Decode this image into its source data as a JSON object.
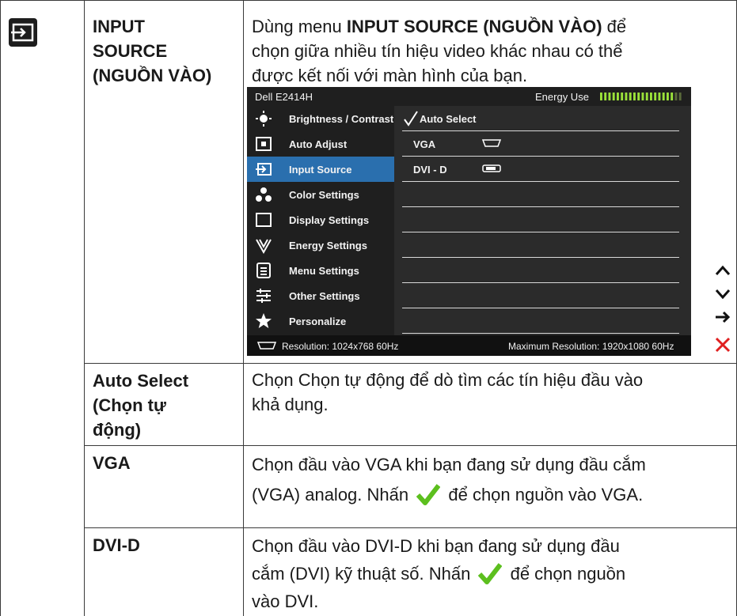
{
  "row1": {
    "label_lines": [
      "INPUT",
      "SOURCE",
      "(NGUỒN VÀO)"
    ],
    "desc_lines": [
      {
        "pre": "Dùng menu ",
        "bold": "INPUT SOURCE (NGUỒN VÀO)",
        "post": " để"
      },
      {
        "pre": "chọn giữa nhiều tín hiệu video khác nhau có thể",
        "bold": "",
        "post": ""
      },
      {
        "pre": "được kết nối với màn hình của bạn.",
        "bold": "",
        "post": ""
      }
    ]
  },
  "osd": {
    "title": "Dell E2414H",
    "energy_label": "Energy Use",
    "energy_level": 0.88,
    "menu": [
      {
        "label": "Brightness / Contrast",
        "icon": "brightness-icon"
      },
      {
        "label": "Auto Adjust",
        "icon": "auto-adjust-icon"
      },
      {
        "label": "Input Source",
        "icon": "input-source-icon"
      },
      {
        "label": "Color Settings",
        "icon": "color-settings-icon"
      },
      {
        "label": "Display Settings",
        "icon": "display-settings-icon"
      },
      {
        "label": "Energy Settings",
        "icon": "energy-settings-icon"
      },
      {
        "label": "Menu Settings",
        "icon": "menu-settings-icon"
      },
      {
        "label": "Other Settings",
        "icon": "other-settings-icon"
      },
      {
        "label": "Personalize",
        "icon": "personalize-icon"
      }
    ],
    "selected_index": 2,
    "options": [
      {
        "label": "Auto Select",
        "checked": true
      },
      {
        "label": "VGA",
        "icon": "vga-connector-icon"
      },
      {
        "label": "DVI - D",
        "icon": "dvi-connector-icon"
      }
    ],
    "footer_left": "Resolution:  1024x768 60Hz",
    "footer_right": "Maximum Resolution: 1920x1080 60Hz",
    "accent": "#2a6fae"
  },
  "side_buttons": [
    "up-arrow-icon",
    "down-arrow-icon",
    "enter-arrow-icon",
    "exit-x-icon"
  ],
  "row2": {
    "label_lines": [
      "Auto Select",
      "(Chọn tự",
      "động)"
    ],
    "desc_lines": [
      "Chọn Chọn tự động để dò tìm các tín hiệu đầu vào",
      "khả dụng."
    ]
  },
  "row3": {
    "label": "VGA",
    "desc_line1": "Chọn đầu vào VGA khi bạn đang sử dụng đầu cắm",
    "desc_line2_pre": "(VGA) analog. Nhấn",
    "desc_line2_post": "để chọn nguồn vào VGA."
  },
  "row4": {
    "label": "DVI-D",
    "desc_line1": "Chọn đầu vào DVI-D khi bạn đang sử dụng đầu",
    "desc_line2_pre": "cắm (DVI) kỹ thuật số. Nhấn",
    "desc_line2_post": "để chọn nguồn",
    "desc_line3": "vào DVI."
  }
}
